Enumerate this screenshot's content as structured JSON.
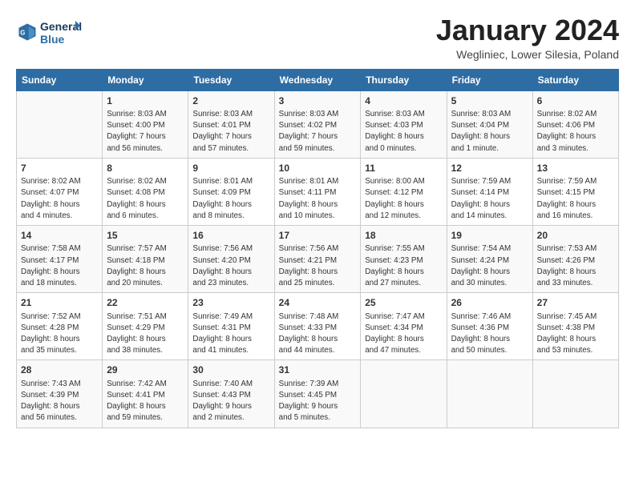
{
  "header": {
    "logo_general": "General",
    "logo_blue": "Blue",
    "month": "January 2024",
    "location": "Wegliniec, Lower Silesia, Poland"
  },
  "days_of_week": [
    "Sunday",
    "Monday",
    "Tuesday",
    "Wednesday",
    "Thursday",
    "Friday",
    "Saturday"
  ],
  "weeks": [
    [
      {
        "day": "",
        "info": ""
      },
      {
        "day": "1",
        "info": "Sunrise: 8:03 AM\nSunset: 4:00 PM\nDaylight: 7 hours\nand 56 minutes."
      },
      {
        "day": "2",
        "info": "Sunrise: 8:03 AM\nSunset: 4:01 PM\nDaylight: 7 hours\nand 57 minutes."
      },
      {
        "day": "3",
        "info": "Sunrise: 8:03 AM\nSunset: 4:02 PM\nDaylight: 7 hours\nand 59 minutes."
      },
      {
        "day": "4",
        "info": "Sunrise: 8:03 AM\nSunset: 4:03 PM\nDaylight: 8 hours\nand 0 minutes."
      },
      {
        "day": "5",
        "info": "Sunrise: 8:03 AM\nSunset: 4:04 PM\nDaylight: 8 hours\nand 1 minute."
      },
      {
        "day": "6",
        "info": "Sunrise: 8:02 AM\nSunset: 4:06 PM\nDaylight: 8 hours\nand 3 minutes."
      }
    ],
    [
      {
        "day": "7",
        "info": "Sunrise: 8:02 AM\nSunset: 4:07 PM\nDaylight: 8 hours\nand 4 minutes."
      },
      {
        "day": "8",
        "info": "Sunrise: 8:02 AM\nSunset: 4:08 PM\nDaylight: 8 hours\nand 6 minutes."
      },
      {
        "day": "9",
        "info": "Sunrise: 8:01 AM\nSunset: 4:09 PM\nDaylight: 8 hours\nand 8 minutes."
      },
      {
        "day": "10",
        "info": "Sunrise: 8:01 AM\nSunset: 4:11 PM\nDaylight: 8 hours\nand 10 minutes."
      },
      {
        "day": "11",
        "info": "Sunrise: 8:00 AM\nSunset: 4:12 PM\nDaylight: 8 hours\nand 12 minutes."
      },
      {
        "day": "12",
        "info": "Sunrise: 7:59 AM\nSunset: 4:14 PM\nDaylight: 8 hours\nand 14 minutes."
      },
      {
        "day": "13",
        "info": "Sunrise: 7:59 AM\nSunset: 4:15 PM\nDaylight: 8 hours\nand 16 minutes."
      }
    ],
    [
      {
        "day": "14",
        "info": "Sunrise: 7:58 AM\nSunset: 4:17 PM\nDaylight: 8 hours\nand 18 minutes."
      },
      {
        "day": "15",
        "info": "Sunrise: 7:57 AM\nSunset: 4:18 PM\nDaylight: 8 hours\nand 20 minutes."
      },
      {
        "day": "16",
        "info": "Sunrise: 7:56 AM\nSunset: 4:20 PM\nDaylight: 8 hours\nand 23 minutes."
      },
      {
        "day": "17",
        "info": "Sunrise: 7:56 AM\nSunset: 4:21 PM\nDaylight: 8 hours\nand 25 minutes."
      },
      {
        "day": "18",
        "info": "Sunrise: 7:55 AM\nSunset: 4:23 PM\nDaylight: 8 hours\nand 27 minutes."
      },
      {
        "day": "19",
        "info": "Sunrise: 7:54 AM\nSunset: 4:24 PM\nDaylight: 8 hours\nand 30 minutes."
      },
      {
        "day": "20",
        "info": "Sunrise: 7:53 AM\nSunset: 4:26 PM\nDaylight: 8 hours\nand 33 minutes."
      }
    ],
    [
      {
        "day": "21",
        "info": "Sunrise: 7:52 AM\nSunset: 4:28 PM\nDaylight: 8 hours\nand 35 minutes."
      },
      {
        "day": "22",
        "info": "Sunrise: 7:51 AM\nSunset: 4:29 PM\nDaylight: 8 hours\nand 38 minutes."
      },
      {
        "day": "23",
        "info": "Sunrise: 7:49 AM\nSunset: 4:31 PM\nDaylight: 8 hours\nand 41 minutes."
      },
      {
        "day": "24",
        "info": "Sunrise: 7:48 AM\nSunset: 4:33 PM\nDaylight: 8 hours\nand 44 minutes."
      },
      {
        "day": "25",
        "info": "Sunrise: 7:47 AM\nSunset: 4:34 PM\nDaylight: 8 hours\nand 47 minutes."
      },
      {
        "day": "26",
        "info": "Sunrise: 7:46 AM\nSunset: 4:36 PM\nDaylight: 8 hours\nand 50 minutes."
      },
      {
        "day": "27",
        "info": "Sunrise: 7:45 AM\nSunset: 4:38 PM\nDaylight: 8 hours\nand 53 minutes."
      }
    ],
    [
      {
        "day": "28",
        "info": "Sunrise: 7:43 AM\nSunset: 4:39 PM\nDaylight: 8 hours\nand 56 minutes."
      },
      {
        "day": "29",
        "info": "Sunrise: 7:42 AM\nSunset: 4:41 PM\nDaylight: 8 hours\nand 59 minutes."
      },
      {
        "day": "30",
        "info": "Sunrise: 7:40 AM\nSunset: 4:43 PM\nDaylight: 9 hours\nand 2 minutes."
      },
      {
        "day": "31",
        "info": "Sunrise: 7:39 AM\nSunset: 4:45 PM\nDaylight: 9 hours\nand 5 minutes."
      },
      {
        "day": "",
        "info": ""
      },
      {
        "day": "",
        "info": ""
      },
      {
        "day": "",
        "info": ""
      }
    ]
  ]
}
